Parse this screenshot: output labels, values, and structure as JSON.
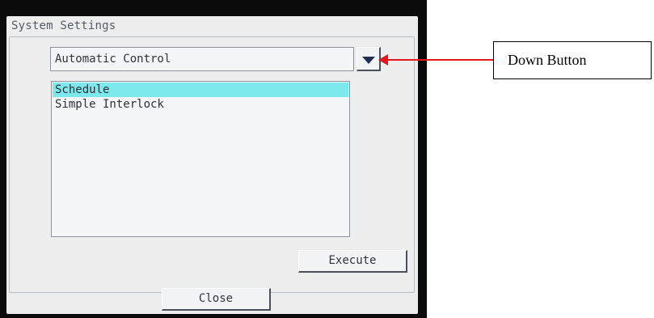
{
  "window": {
    "title": "System Settings"
  },
  "dropdown": {
    "selected_value": "Automatic Control",
    "button_icon": "chevron-down-icon"
  },
  "list": {
    "items": [
      {
        "label": "Schedule",
        "selected": true
      },
      {
        "label": "Simple Interlock",
        "selected": false
      }
    ]
  },
  "buttons": {
    "execute_label": "Execute",
    "close_label": "Close"
  },
  "annotation": {
    "label": "Down Button",
    "arrow_color": "#e5171d"
  },
  "colors": {
    "selection_highlight": "#7ee9ec",
    "bezel": "#0b0b0b",
    "panel": "#ededee"
  }
}
